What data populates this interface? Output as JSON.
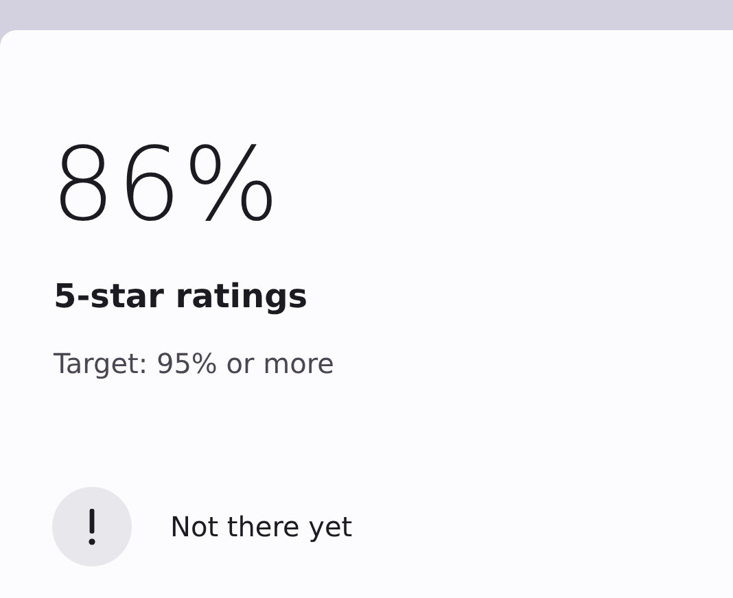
{
  "metric": {
    "value": "86%",
    "title": "5-star ratings",
    "target": "Target: 95% or more"
  },
  "status": {
    "kind": "warning",
    "label": "Not there yet"
  }
}
